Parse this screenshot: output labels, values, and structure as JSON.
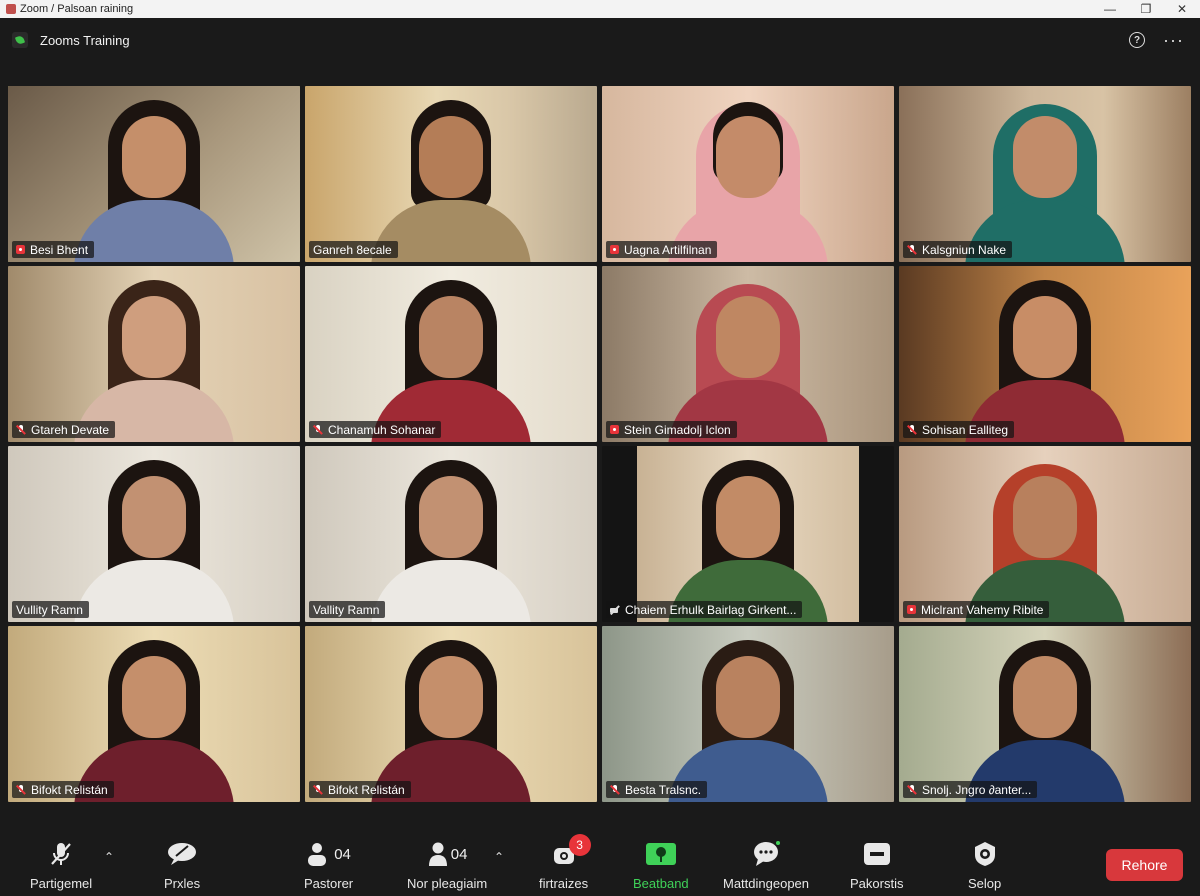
{
  "window": {
    "title": "Zoom / Palsoan raining"
  },
  "header": {
    "meeting_title": "Zooms Training"
  },
  "participants": [
    {
      "name": "Besi Bhent",
      "status_icon": "record-icon"
    },
    {
      "name": "Ganreh 8ecale",
      "status_icon": ""
    },
    {
      "name": "Uagna Artilfilnan",
      "status_icon": "record-icon"
    },
    {
      "name": "Kalsgniun Nake",
      "status_icon": "mic-muted-icon"
    },
    {
      "name": "Gtareh Devate",
      "status_icon": "mic-muted-icon"
    },
    {
      "name": "Chanamuh Sohanar",
      "status_icon": "mic-muted-icon"
    },
    {
      "name": "Stein Gimadolj Iclon",
      "status_icon": "record-icon"
    },
    {
      "name": "Sohisan Ealliteg",
      "status_icon": "mic-muted-icon"
    },
    {
      "name": "Vullity Ramn",
      "status_icon": ""
    },
    {
      "name": "Vallity Ramn",
      "status_icon": ""
    },
    {
      "name": "Chaiem Erhulk Bairlag Girkent...",
      "status_icon": "camera-off-icon"
    },
    {
      "name": "Miclrant Vahemy Ribite",
      "status_icon": "record-icon"
    },
    {
      "name": "Bifokt Relistán",
      "status_icon": "mic-muted-icon"
    },
    {
      "name": "Bifokt Relistán",
      "status_icon": "mic-muted-icon"
    },
    {
      "name": "Besta Tralsnc.",
      "status_icon": "mic-muted-icon"
    },
    {
      "name": "Snolj. Jngro ∂anter...",
      "status_icon": "mic-muted-icon"
    }
  ],
  "toolbar": {
    "mute_label": "Partigemel",
    "video_label": "Prxles",
    "participants_count": "04",
    "participants_label": "Pastorer",
    "share_count": "04",
    "share_label": "Nor pleagiaim",
    "chat_badge": "3",
    "chat_label": "firtraizes",
    "active_label": "Beatband",
    "messages_label": "Mattdingeopen",
    "record_label": "Pakorstis",
    "settings_label": "Selop",
    "end_label": "Rehore"
  },
  "colors": {
    "active_speaker_border": "#b7e06a",
    "end_button": "#d8383c",
    "active_green": "#3fd158",
    "badge_red": "#e8343a"
  }
}
